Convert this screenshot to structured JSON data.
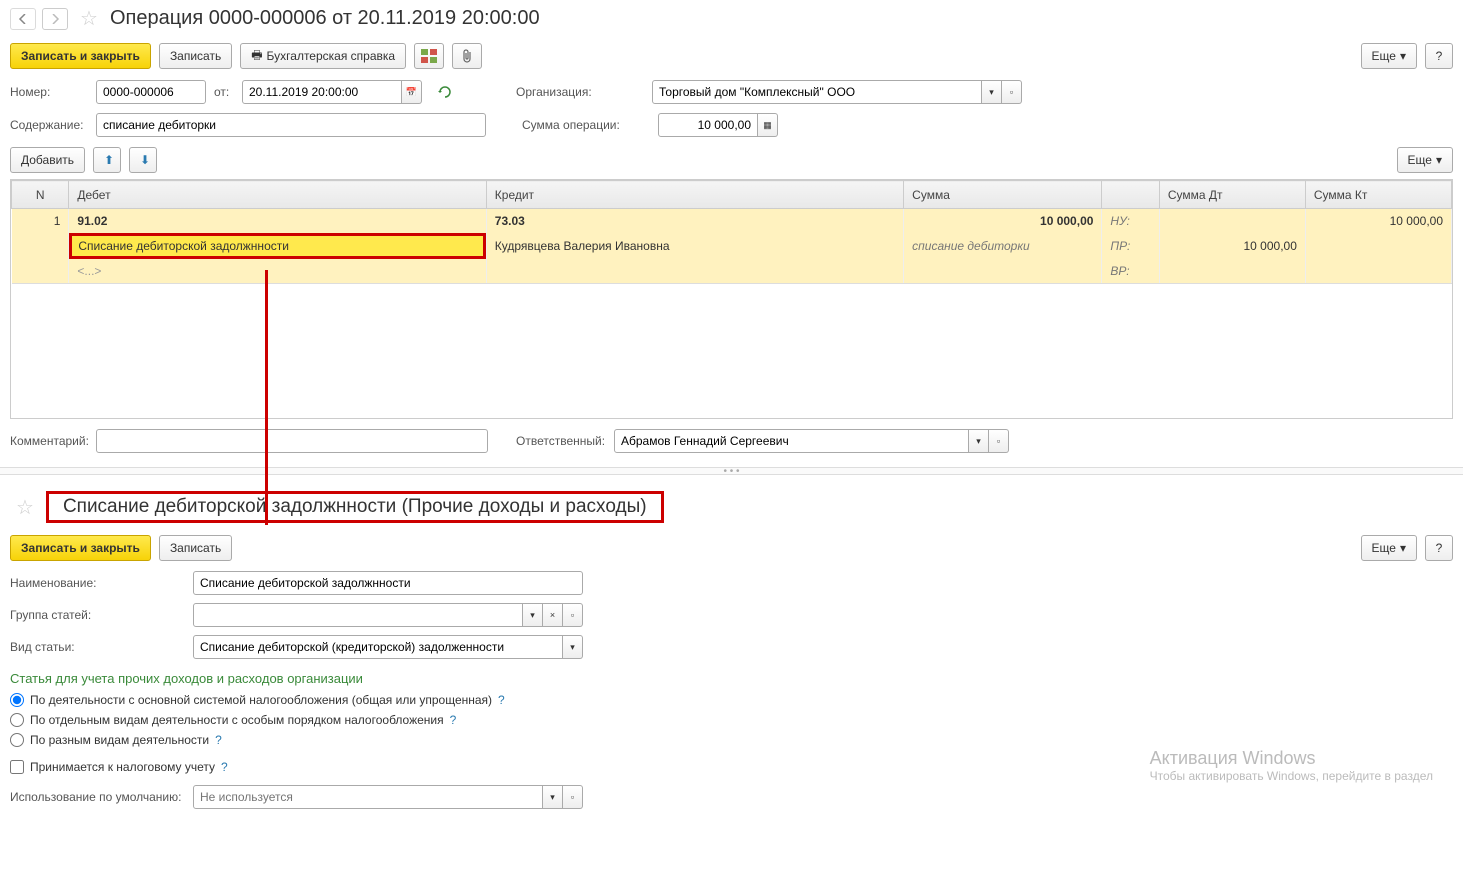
{
  "top": {
    "title": "Операция 0000-000006 от 20.11.2019 20:00:00",
    "write_close": "Записать и закрыть",
    "write": "Записать",
    "print_ref": "Бухгалтерская справка",
    "more": "Еще",
    "help": "?"
  },
  "form": {
    "number_label": "Номер:",
    "number_value": "0000-000006",
    "from_label": "от:",
    "date_value": "20.11.2019 20:00:00",
    "org_label": "Организация:",
    "org_value": "Торговый дом \"Комплексный\" ООО",
    "content_label": "Содержание:",
    "content_value": "списание дебиторки",
    "sum_label": "Сумма операции:",
    "sum_value": "10 000,00",
    "add": "Добавить",
    "more": "Еще"
  },
  "table": {
    "h_n": "N",
    "h_debit": "Дебет",
    "h_credit": "Кредит",
    "h_sum": "Сумма",
    "h_sum_dt": "Сумма Дт",
    "h_sum_kt": "Сумма Кт",
    "r1_n": "1",
    "r1_debit": "91.02",
    "r1_credit": "73.03",
    "r1_sum": "10 000,00",
    "r1_nu": "НУ:",
    "r1_kt": "10 000,00",
    "r2_debit": "Списание дебиторской задолжнности",
    "r2_credit": "Кудрявцева Валерия Ивановна",
    "r2_desc": "списание дебиторки",
    "r2_pr": "ПР:",
    "r2_dt": "10 000,00",
    "r3_debit": "<...>",
    "r3_vr": "ВР:"
  },
  "footer": {
    "comment_label": "Комментарий:",
    "resp_label": "Ответственный:",
    "resp_value": "Абрамов Геннадий Сергеевич"
  },
  "card": {
    "title": "Списание дебиторской задолжнности (Прочие доходы и расходы)",
    "write_close": "Записать и закрыть",
    "write": "Записать",
    "more": "Еще",
    "help": "?",
    "name_label": "Наименование:",
    "name_value": "Списание дебиторской задолжнности",
    "group_label": "Группа статей:",
    "kind_label": "Вид статьи:",
    "kind_value": "Списание дебиторской (кредиторской) задолженности",
    "section": "Статья для учета прочих доходов и расходов организации",
    "radio1": "По деятельности с основной системой налогообложения (общая или упрощенная)",
    "radio2": "По отдельным видам деятельности с особым порядком налогообложения",
    "radio3": "По разным видам деятельности",
    "check1": "Принимается к налоговому учету",
    "default_label": "Использование по умолчанию:",
    "default_placeholder": "Не используется"
  },
  "watermark": {
    "title": "Активация Windows",
    "sub": "Чтобы активировать Windows, перейдите в раздел"
  }
}
